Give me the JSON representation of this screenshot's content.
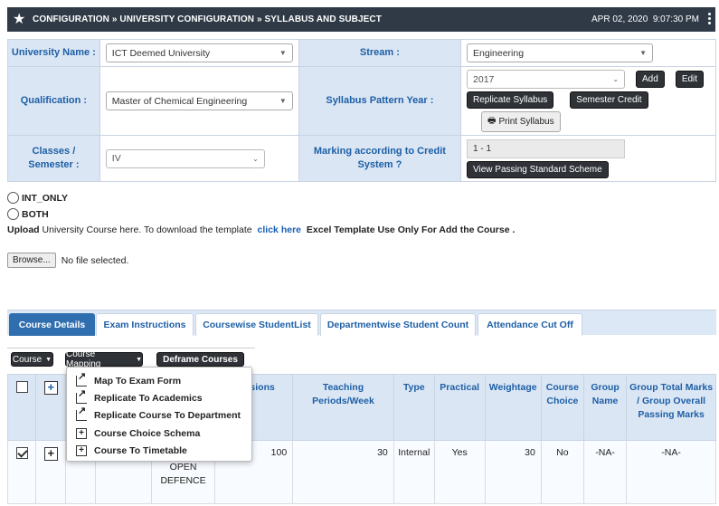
{
  "header": {
    "breadcrumb": "CONFIGURATION » UNIVERSITY CONFIGURATION » SYLLABUS AND SUBJECT",
    "date": "APR 02, 2020",
    "time": "9:07:30 PM"
  },
  "form": {
    "university_label": "University Name :",
    "university_value": "ICT Deemed University",
    "stream_label": "Stream :",
    "stream_value": "Engineering",
    "qualification_label": "Qualification :",
    "qualification_value": "Master of Chemical Engineering",
    "pattern_label": "Syllabus Pattern Year :",
    "pattern_value": "2017",
    "add_label": "Add",
    "edit_label": "Edit",
    "replicate_label": "Replicate Syllabus",
    "semester_credit_label": "Semester Credit",
    "print_label": "Print Syllabus",
    "classes_label": "Classes / Semester :",
    "classes_value": "IV",
    "marking_label": "Marking according to Credit System ?",
    "marking_value": "1 - 1",
    "passing_label": "View Passing Standard Scheme"
  },
  "radios": [
    {
      "label": "INT_ONLY"
    },
    {
      "label": "BOTH"
    }
  ],
  "upload": {
    "upload_word": "Upload",
    "text": "University Course here. To download the template",
    "link": "click here",
    "note": "Excel Template Use Only For Add the Course ."
  },
  "file": {
    "browse_label": "Browse...",
    "status": "No file selected."
  },
  "tabs": [
    {
      "label": "Course Details",
      "active": true
    },
    {
      "label": "Exam Instructions"
    },
    {
      "label": "Coursewise StudentList"
    },
    {
      "label": "Departmentwise Student Count"
    },
    {
      "label": "Attendance Cut Off"
    }
  ],
  "toolbar": {
    "course_label": "Course",
    "mapping_label": "Course Mapping",
    "deframe_label": "Deframe Courses"
  },
  "menu": {
    "items": [
      {
        "label": "Map To Exam Form",
        "icon": "share-icon"
      },
      {
        "label": "Replicate To Academics",
        "icon": "share-icon"
      },
      {
        "label": "Replicate Course To Department",
        "icon": "share-icon"
      },
      {
        "label": "Course Choice Schema",
        "icon": "plus-square-icon"
      },
      {
        "label": "Course To Timetable",
        "icon": "plus-square-icon"
      }
    ]
  },
  "table": {
    "headers": {
      "partial": "on",
      "sessions": "Sessions",
      "teaching": "Teaching Periods/Week",
      "type": "Type",
      "practical": "Practical",
      "weightage": "Weightage",
      "choice": "Course Choice",
      "group": "Group Name",
      "group_total": "Group Total Marks / Group Overall Passing Marks"
    },
    "row": {
      "course_name": "THESIS AND OPEN DEFENCE",
      "sessions": "100",
      "teaching": "30",
      "type": "Internal",
      "practical": "Yes",
      "weightage": "30",
      "choice": "No",
      "group": "-NA-",
      "group_total": "-NA-"
    }
  }
}
